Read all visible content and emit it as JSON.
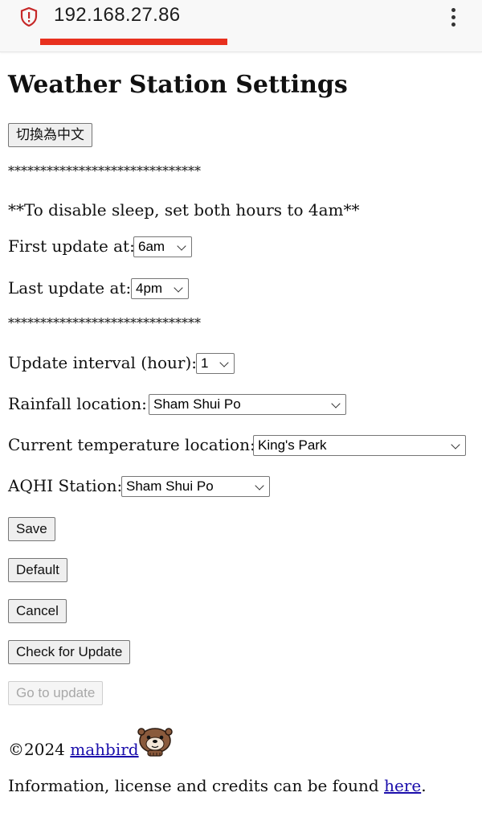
{
  "browser": {
    "url": "192.168.27.86"
  },
  "page": {
    "title": "Weather Station Settings",
    "language_button": "切換為中文",
    "separator": "******************************",
    "sleep_note": "**To disable sleep, set both hours to 4am**",
    "first_update": {
      "label": "First update at:",
      "value": "6am"
    },
    "last_update": {
      "label": "Last update at:",
      "value": "4pm"
    },
    "update_interval": {
      "label": "Update interval (hour):",
      "value": "1"
    },
    "rainfall": {
      "label": "Rainfall location:",
      "value": "Sham Shui Po"
    },
    "temperature": {
      "label": "Current temperature location:",
      "value": "King's Park"
    },
    "aqhi": {
      "label": "AQHI Station:",
      "value": "Sham Shui Po"
    },
    "buttons": {
      "save": "Save",
      "default": "Default",
      "cancel": "Cancel",
      "check_update": "Check for Update",
      "go_update": "Go to update"
    },
    "footer": {
      "copyright": "©2024 ",
      "author": "mahbird",
      "info_prefix": "Information, license and credits can be found ",
      "info_link": "here",
      "info_suffix": "."
    }
  },
  "colors": {
    "url_underline": "#e8301e",
    "shield_icon": "#c62828",
    "link": "#1a0dab"
  }
}
